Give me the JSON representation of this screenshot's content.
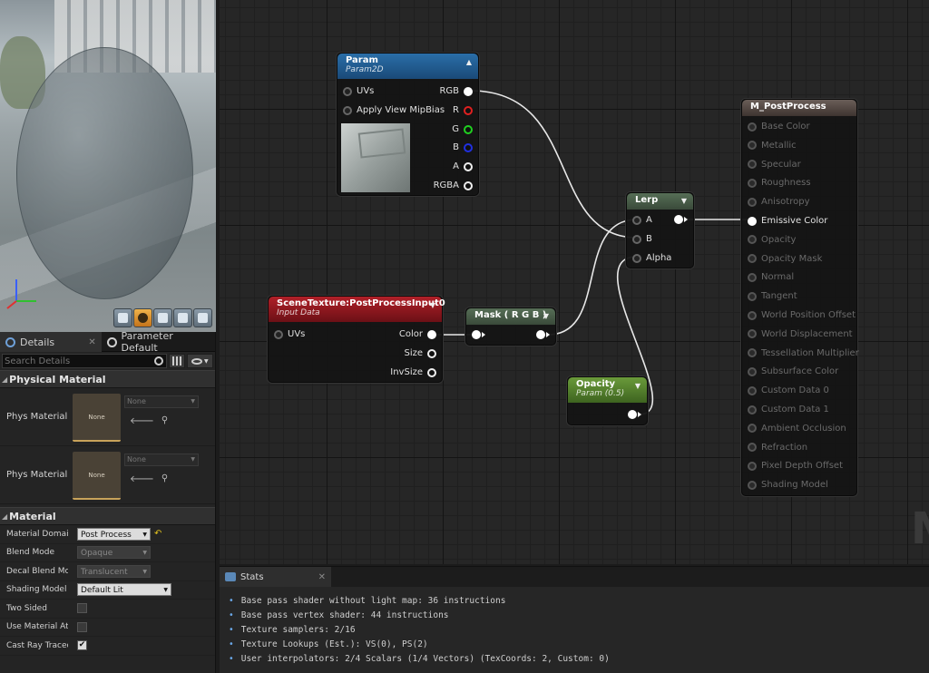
{
  "details_panel": {
    "tabs": [
      {
        "label": "Details"
      },
      {
        "label": "Parameter Default"
      }
    ],
    "search_placeholder": "Search Details",
    "sections": {
      "physical_material": "Physical Material",
      "material": "Material"
    },
    "phys_rows": [
      {
        "label": "Phys Material",
        "thumb": "None",
        "value": "None"
      },
      {
        "label": "Phys Material M",
        "thumb": "None",
        "value": "None"
      }
    ],
    "material_props": [
      {
        "label": "Material Domain",
        "type": "dropdown",
        "value": "Post Process",
        "enabled": true,
        "reset": true
      },
      {
        "label": "Blend Mode",
        "type": "dropdown",
        "value": "Opaque",
        "enabled": false
      },
      {
        "label": "Decal Blend Mod",
        "type": "dropdown",
        "value": "Translucent",
        "enabled": false
      },
      {
        "label": "Shading Model",
        "type": "dropdown",
        "value": "Default Lit",
        "enabled": true
      },
      {
        "label": "Two Sided",
        "type": "checkbox",
        "checked": false
      },
      {
        "label": "Use Material Attr",
        "type": "checkbox",
        "checked": false
      },
      {
        "label": "Cast Ray Traced",
        "type": "checkbox",
        "checked": true
      }
    ]
  },
  "nodes": {
    "param": {
      "title": "Param",
      "subtitle": "Param2D",
      "inputs": [
        "UVs",
        "Apply View MipBias"
      ],
      "outputs": [
        "RGB",
        "R",
        "G",
        "B",
        "A",
        "RGBA"
      ]
    },
    "lerp": {
      "title": "Lerp",
      "inputs": [
        "A",
        "B",
        "Alpha"
      ]
    },
    "result": {
      "title": "M_PostProcess",
      "pins": [
        {
          "label": "Base Color",
          "active": false
        },
        {
          "label": "Metallic",
          "active": false
        },
        {
          "label": "Specular",
          "active": false
        },
        {
          "label": "Roughness",
          "active": false
        },
        {
          "label": "Anisotropy",
          "active": false
        },
        {
          "label": "Emissive Color",
          "active": true
        },
        {
          "label": "Opacity",
          "active": false
        },
        {
          "label": "Opacity Mask",
          "active": false
        },
        {
          "label": "Normal",
          "active": false
        },
        {
          "label": "Tangent",
          "active": false
        },
        {
          "label": "World Position Offset",
          "active": false
        },
        {
          "label": "World Displacement",
          "active": false
        },
        {
          "label": "Tessellation Multiplier",
          "active": false
        },
        {
          "label": "Subsurface Color",
          "active": false
        },
        {
          "label": "Custom Data 0",
          "active": false
        },
        {
          "label": "Custom Data 1",
          "active": false
        },
        {
          "label": "Ambient Occlusion",
          "active": false
        },
        {
          "label": "Refraction",
          "active": false
        },
        {
          "label": "Pixel Depth Offset",
          "active": false
        },
        {
          "label": "Shading Model",
          "active": false
        }
      ]
    },
    "scene_texture": {
      "title": "SceneTexture:PostProcessInput0",
      "subtitle": "Input Data",
      "inputs": [
        "UVs"
      ],
      "outputs": [
        "Color",
        "Size",
        "InvSize"
      ]
    },
    "mask": {
      "title": "Mask ( R G B )"
    },
    "opacity": {
      "title": "Opacity",
      "subtitle": "Param (0.5)"
    }
  },
  "watermark": "M",
  "stats": {
    "tab_label": "Stats",
    "lines": [
      "Base pass shader without light map: 36 instructions",
      "Base pass vertex shader: 44 instructions",
      "Texture samplers: 2/16",
      "Texture Lookups (Est.): VS(0), PS(2)",
      "User interpolators: 2/4 Scalars (1/4 Vectors) (TexCoords: 2, Custom: 0)"
    ]
  },
  "colors": {
    "param_header": "#2a6ea8",
    "scene_header": "#b02028",
    "math_header": "#566e56",
    "opacity_header": "#6a9a3a",
    "result_header": "#6a5e58",
    "pin_r": "#e02020",
    "pin_g": "#20d020",
    "pin_b": "#2030e0"
  }
}
